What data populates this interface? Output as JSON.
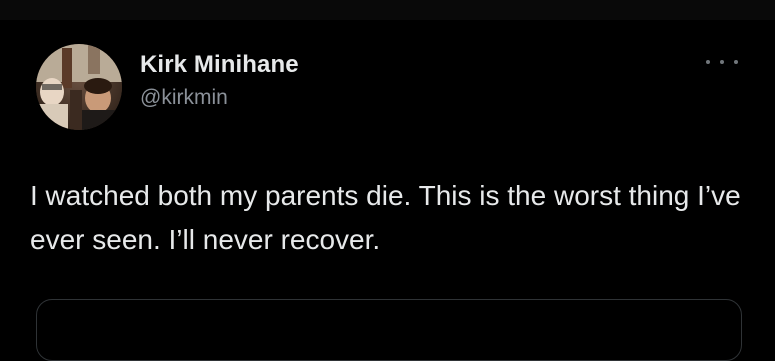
{
  "tweet": {
    "author": {
      "display_name": "Kirk Minihane",
      "handle": "@kirkmin"
    },
    "text": "I watched both my parents die. This is the worst thing I’ve ever seen. I’ll never recover.",
    "icons": {
      "more": "more-horizontal-icon",
      "avatar": "profile-photo"
    }
  },
  "colors": {
    "background": "#000000",
    "primary_text": "#e7e9ea",
    "secondary_text": "#8b9199",
    "border": "#2f3336"
  }
}
